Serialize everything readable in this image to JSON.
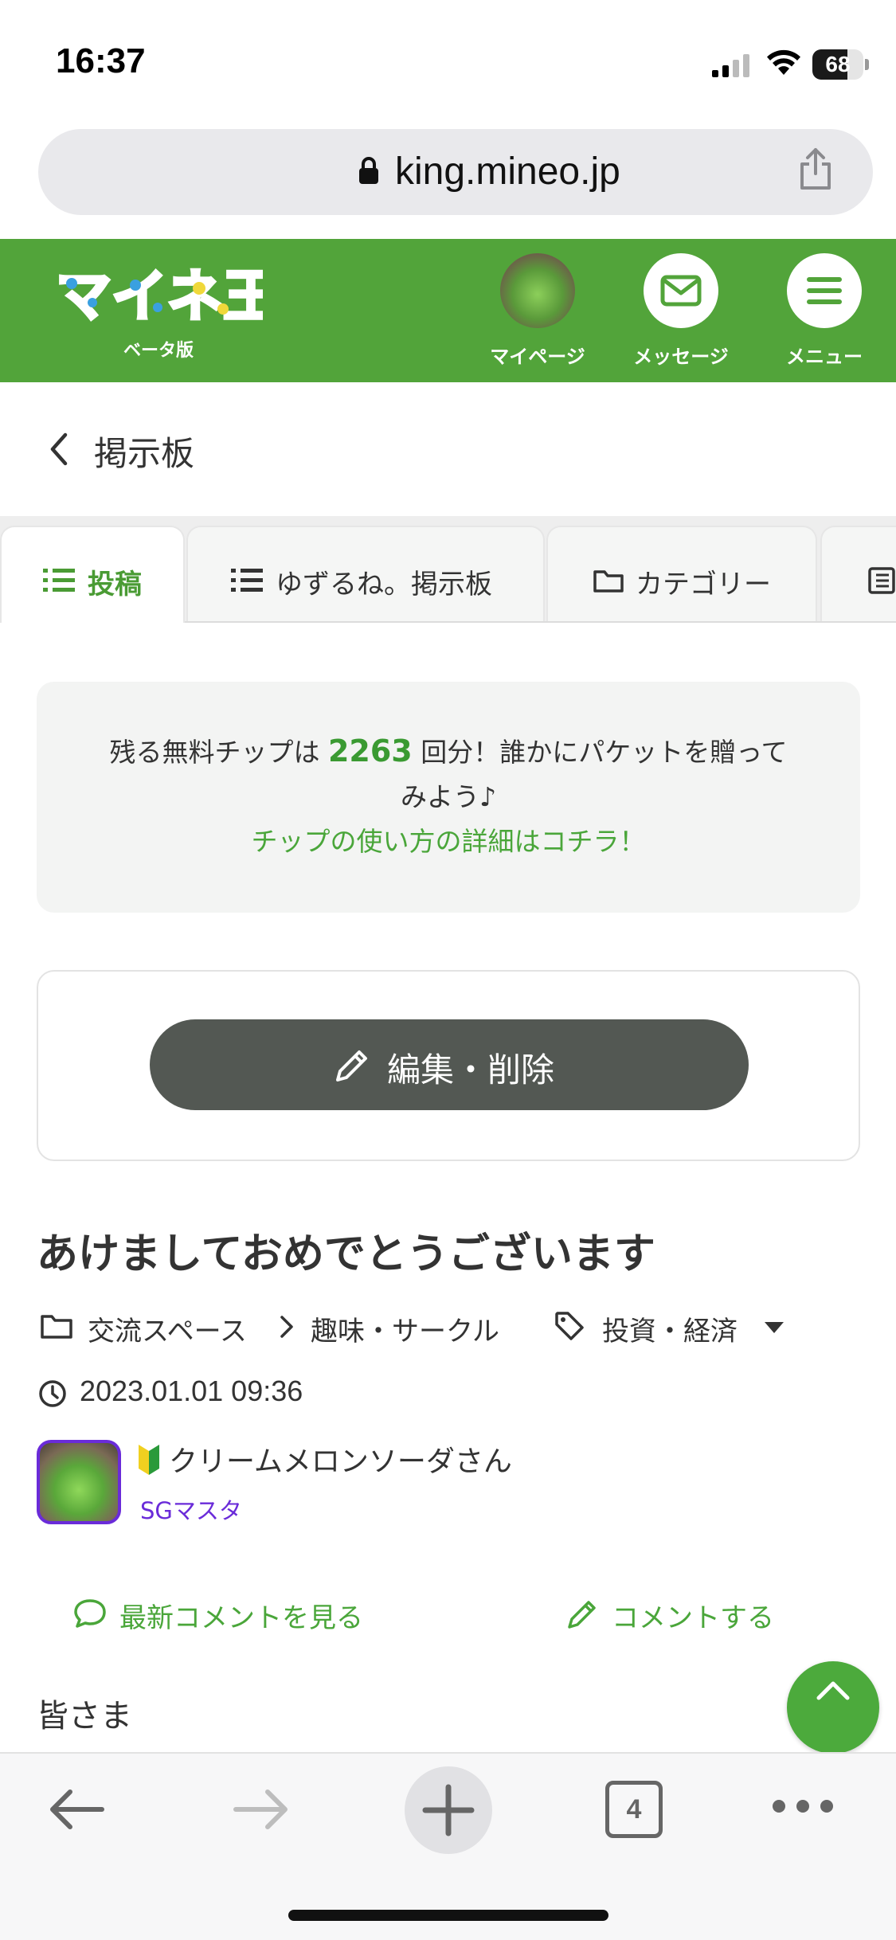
{
  "status_bar": {
    "time": "16:37",
    "battery_percent": 68,
    "battery_label": "68"
  },
  "browser": {
    "url": "king.mineo.jp",
    "tab_count": "4"
  },
  "header": {
    "logo_text": "マイネ王",
    "logo_sub": "ベータ版",
    "mypage_label": "マイページ",
    "message_label": "メッセージ",
    "menu_label": "メニュー",
    "brand_color": "#52a43a"
  },
  "nav": {
    "back_title": "掲示板"
  },
  "tabs": [
    {
      "label": "投稿",
      "active": true
    },
    {
      "label": "ゆずるね。掲示板",
      "active": false
    },
    {
      "label": "カテゴリー",
      "active": false
    }
  ],
  "chip": {
    "prefix": "残る無料チップは",
    "count": "2263",
    "suffix": "回分！誰かにパケットを贈って",
    "line2": "みよう♪",
    "link": "チップの使い方の詳細はコチラ！"
  },
  "edit": {
    "button_label": "編集・削除"
  },
  "post": {
    "title": "あけましておめでとうございます",
    "category_parent": "交流スペース",
    "category_child": "趣味・サークル",
    "tag": "投資・経済",
    "datetime": "2023.01.01 09:36",
    "author": "クリームメロンソーダさん",
    "rank": "SGマスタ",
    "view_comments": "最新コメントを見る",
    "write_comment": "コメントする",
    "body_start": "皆さま"
  }
}
